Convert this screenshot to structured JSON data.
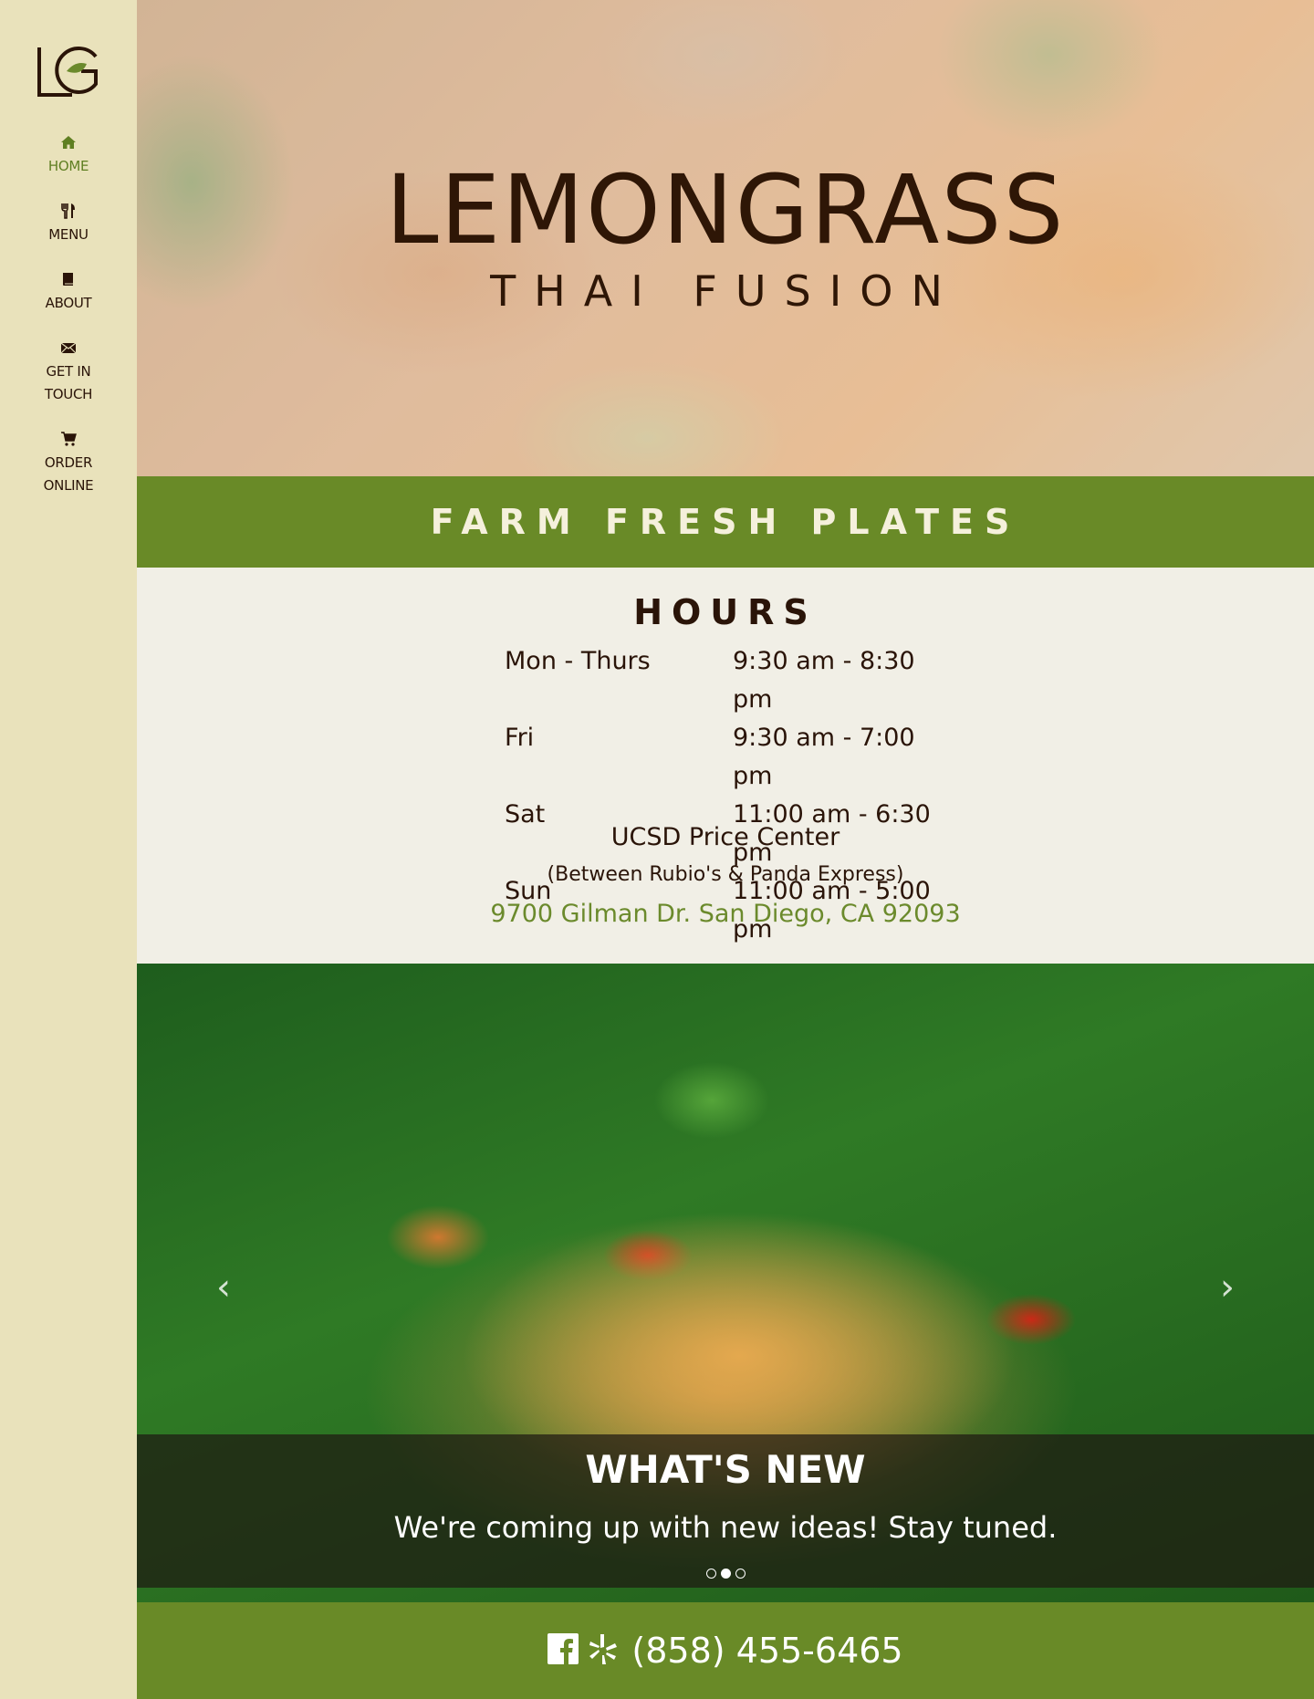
{
  "sidebar": {
    "logo_icon": "lg-monogram-logo",
    "items": [
      {
        "label": "HOME",
        "icon": "home-icon",
        "active": true
      },
      {
        "label": "MENU",
        "icon": "fork-knife-icon"
      },
      {
        "label": "ABOUT",
        "icon": "book-icon"
      },
      {
        "label": "GET IN\nTOUCH",
        "icon": "envelope-icon"
      },
      {
        "label": "ORDER\nONLINE",
        "icon": "cart-icon"
      }
    ]
  },
  "hero": {
    "title": "LEMONGRASS",
    "subtitle": "THAI FUSION"
  },
  "tagline": "FARM FRESH PLATES",
  "hours": {
    "title": "HOURS",
    "rows": [
      {
        "day": "Mon - Thurs",
        "time": "9:30 am - 8:30 pm"
      },
      {
        "day": "Fri",
        "time": "9:30 am - 7:00 pm"
      },
      {
        "day": "Sat",
        "time": "11:00 am - 6:30 pm"
      },
      {
        "day": "Sun",
        "time": "11:00 am - 5:00 pm"
      }
    ],
    "venue": "UCSD Price Center",
    "venue_note": "(Between Rubio's & Panda Express)",
    "address": "9700 Gilman Dr. San Diego, CA 92093"
  },
  "carousel": {
    "caption_title": "WHAT'S NEW",
    "caption_text": "We're coming up with new ideas! Stay tuned.",
    "slide_count": 3,
    "active_slide": 2
  },
  "footer": {
    "icons": [
      "facebook-icon",
      "yelp-icon"
    ],
    "phone": "(858) 455-6465"
  },
  "colors": {
    "sidebar_bg": "#e9e2bb",
    "accent_green": "#698a27",
    "dark_brown": "#2a1408",
    "page_bg": "#f1efe6"
  }
}
